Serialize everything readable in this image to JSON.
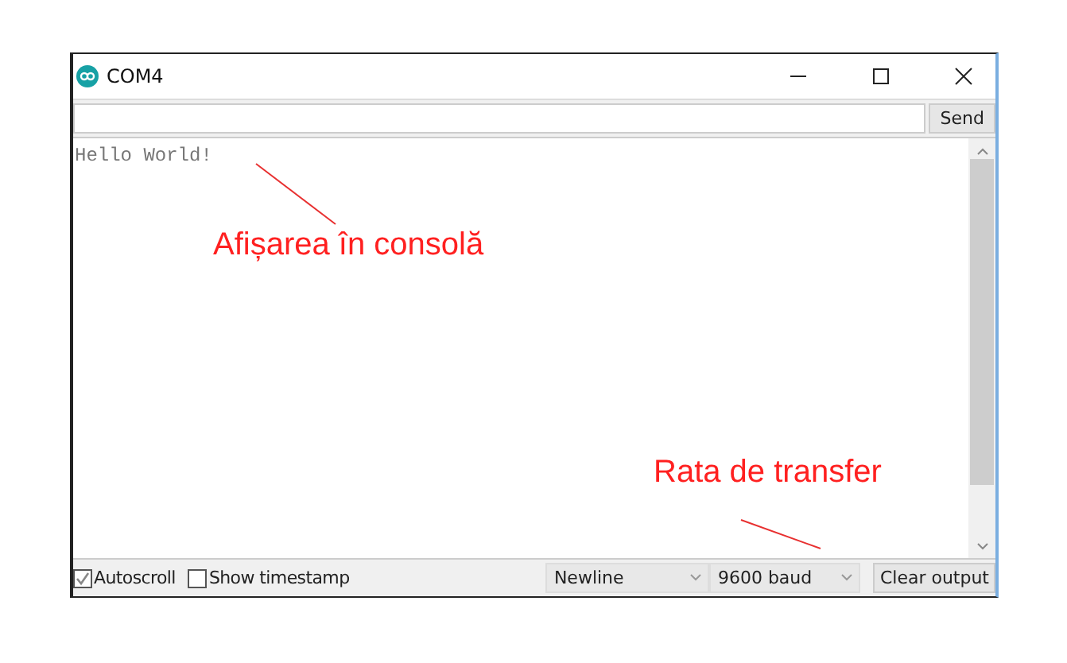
{
  "window": {
    "title": "COM4"
  },
  "input": {
    "button": "Send"
  },
  "console": {
    "lines": [
      "Hello World!"
    ]
  },
  "annotations": [
    {
      "text": "Afișarea în consolă"
    },
    {
      "text": "Rata de transfer"
    }
  ],
  "bottom_bar": {
    "autoscroll": {
      "label": "Autoscroll",
      "checked": true
    },
    "timestamp": {
      "label": "Show timestamp",
      "checked": false
    },
    "line_ending": "Newline",
    "baud": "9600 baud",
    "clear_button": "Clear output"
  }
}
